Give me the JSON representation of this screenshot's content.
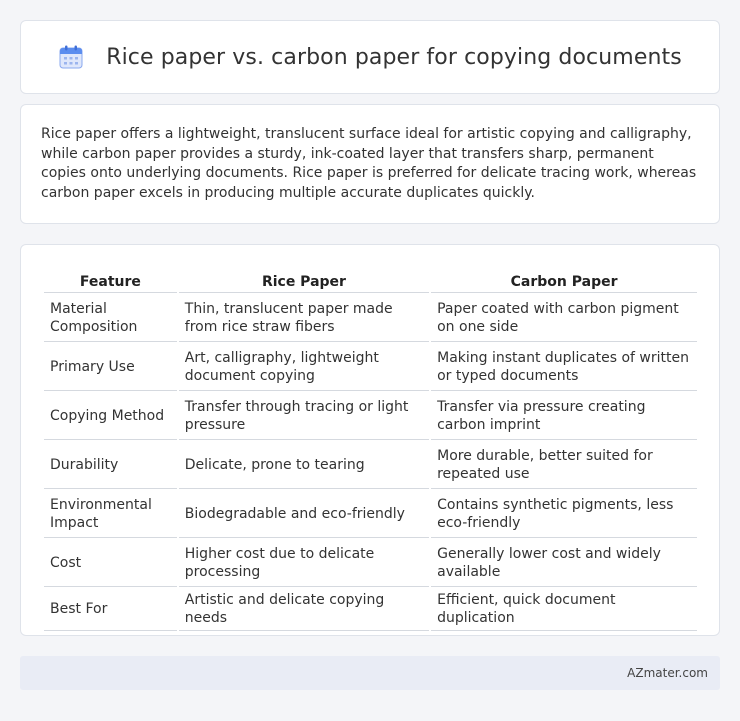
{
  "header": {
    "icon": "calendar-icon",
    "title": "Rice paper vs. carbon paper for copying documents"
  },
  "summary": {
    "text": "Rice paper offers a lightweight, translucent surface ideal for artistic copying and calligraphy, while carbon paper provides a sturdy, ink-coated layer that transfers sharp, permanent copies onto underlying documents. Rice paper is preferred for delicate tracing work, whereas carbon paper excels in producing multiple accurate duplicates quickly."
  },
  "table": {
    "headers": [
      "Feature",
      "Rice Paper",
      "Carbon Paper"
    ],
    "rows": [
      [
        "Material Composition",
        "Thin, translucent paper made from rice straw fibers",
        "Paper coated with carbon pigment on one side"
      ],
      [
        "Primary Use",
        "Art, calligraphy, lightweight document copying",
        "Making instant duplicates of written or typed documents"
      ],
      [
        "Copying Method",
        "Transfer through tracing or light pressure",
        "Transfer via pressure creating carbon imprint"
      ],
      [
        "Durability",
        "Delicate, prone to tearing",
        "More durable, better suited for repeated use"
      ],
      [
        "Environmental Impact",
        "Biodegradable and eco-friendly",
        "Contains synthetic pigments, less eco-friendly"
      ],
      [
        "Cost",
        "Higher cost due to delicate processing",
        "Generally lower cost and widely available"
      ],
      [
        "Best For",
        "Artistic and delicate copying needs",
        "Efficient, quick document duplication"
      ]
    ]
  },
  "footer": {
    "brand": "AZmater.com"
  },
  "colors": {
    "icon_blue": "#5b8def",
    "icon_light": "#c9d8f7",
    "footer_bg": "#e9ecf5"
  }
}
